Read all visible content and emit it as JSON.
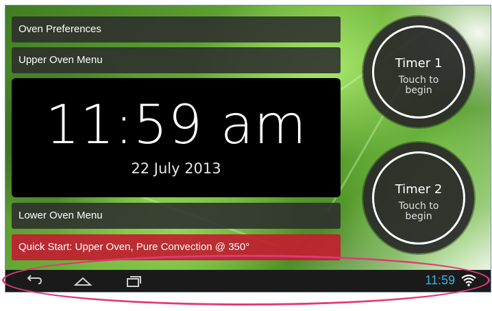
{
  "menus": {
    "oven_preferences": "Oven Preferences",
    "upper_oven_menu": "Upper Oven Menu",
    "lower_oven_menu": "Lower Oven Menu",
    "quick_start": "Quick Start: Upper Oven, Pure Convection @ 350°"
  },
  "clock": {
    "time": "11:59 am",
    "date": "22 July 2013"
  },
  "timers": [
    {
      "title": "Timer 1",
      "line1": "Touch to",
      "line2": "begin"
    },
    {
      "title": "Timer 2",
      "line1": "Touch to",
      "line2": "begin"
    }
  ],
  "nav_bar": {
    "icons": [
      "back-icon",
      "home-icon",
      "recent-apps-icon"
    ],
    "status_time": "11:59",
    "status_icon": "wifi-icon",
    "status_time_color": "#33b5e5"
  },
  "colors": {
    "quick_start_bg": "#c02030",
    "highlight": "#e03a7a"
  }
}
